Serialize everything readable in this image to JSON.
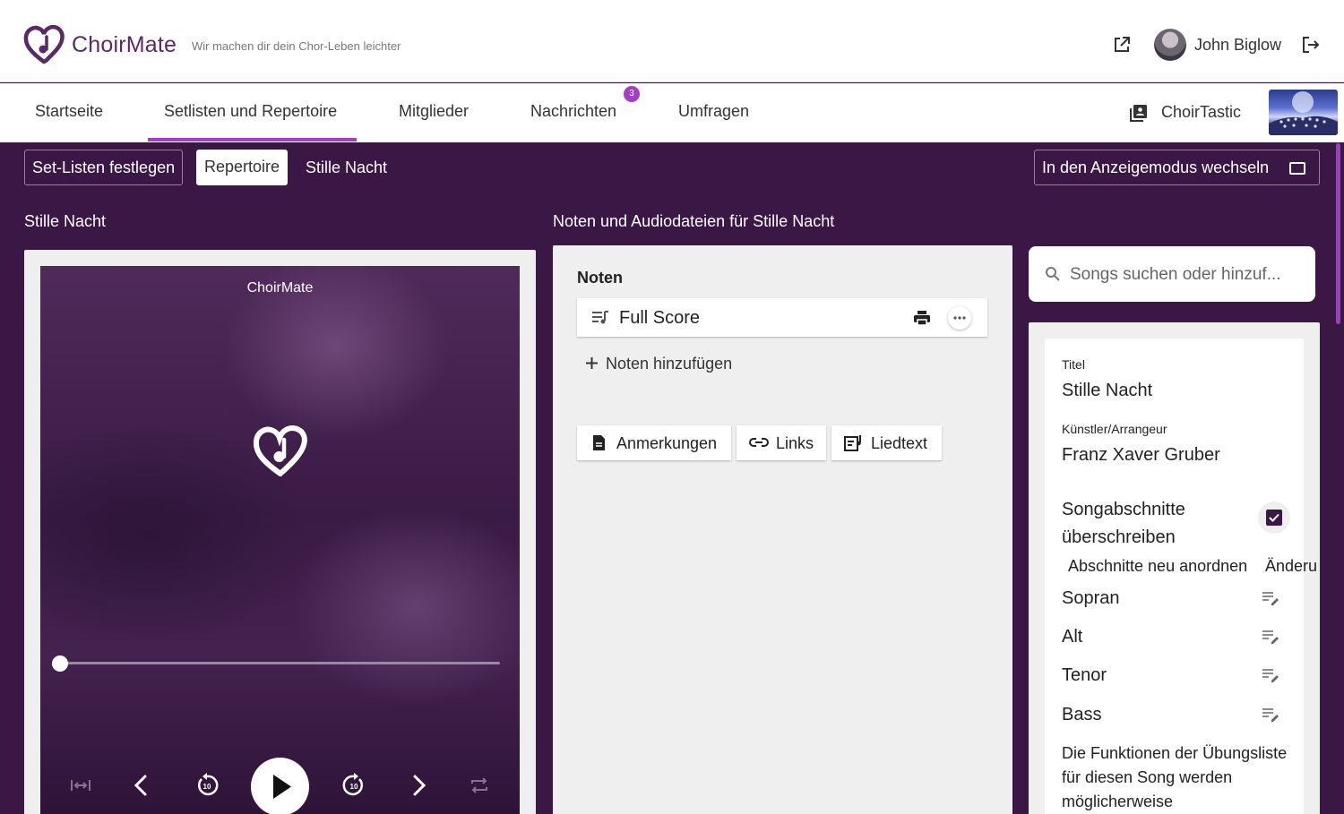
{
  "header": {
    "brand": "ChoirMate",
    "tagline": "Wir machen dir dein Chor-Leben leichter",
    "user_name": "John Biglow"
  },
  "nav": {
    "items": [
      "Startseite",
      "Setlisten und Repertoire",
      "Mitglieder",
      "Nachrichten",
      "Umfragen"
    ],
    "active_index": 1,
    "messages_badge": "3",
    "choir_name": "ChoirTastic"
  },
  "toolbar": {
    "setlists_label": "Set-Listen festlegen",
    "repertoire_label": "Repertoire",
    "crumb": "Stille Nacht",
    "display_mode_label": "In den Anzeigemodus wechseln"
  },
  "left": {
    "section_title": "Stille Nacht",
    "player_title": "ChoirMate",
    "progress": 0.0
  },
  "middle": {
    "section_title": "Noten und Audiodateien für Stille Nacht",
    "notes_heading": "Noten",
    "score_name": "Full Score",
    "add_notes_label": "Noten hinzufügen",
    "chips": [
      "Anmerkungen",
      "Links",
      "Liedtext"
    ]
  },
  "search": {
    "placeholder": "Songs suchen oder hinzuf..."
  },
  "details": {
    "title_label": "Titel",
    "title_value": "Stille Nacht",
    "artist_label": "Künstler/Arrangeur",
    "artist_value": "Franz Xaver Gruber",
    "override_line1": "Songabschnitte",
    "override_line2": "überschreiben",
    "override_checked": true,
    "reorder_label": "Abschnitte neu anordnen",
    "changes_label": "Änderu",
    "parts": [
      "Sopran",
      "Alt",
      "Tenor",
      "Bass"
    ],
    "warning": "Die Funktionen der Übungsliste für diesen Song werden möglicherweise"
  },
  "colors": {
    "primary_dark": "#3b1745",
    "accent": "#a63cc7"
  }
}
